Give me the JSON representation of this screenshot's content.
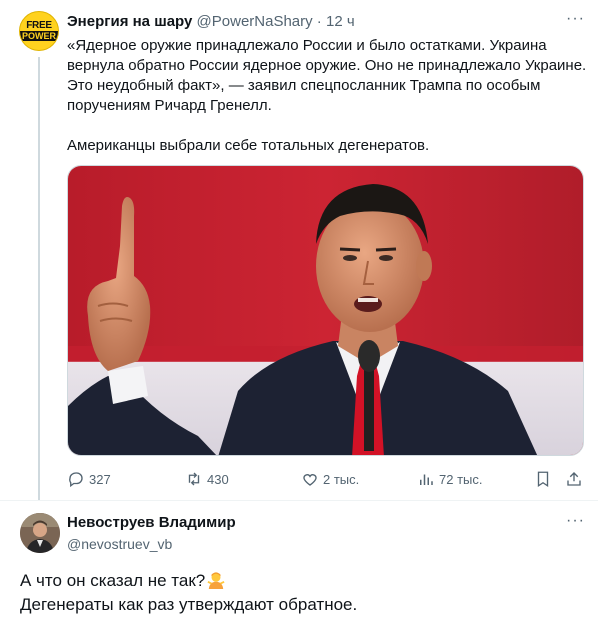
{
  "tweet": {
    "author_name": "Энергия на шару",
    "author_handle": "@PowerNaShary",
    "separator": " · ",
    "time": "12 ч",
    "avatar_text_top": "FREE",
    "avatar_text_bottom": "POWER",
    "paragraph1": "«Ядерное оружие принадлежало России и было остатками. Украина вернула обратно России ядерное оружие. Оно не принадлежало Украине. Это неудобный факт», — заявил спецпосланник Трампа по особым поручениям Ричард Гренелл.",
    "paragraph2": "Американцы выбрали себе тотальных дегенератов.",
    "more": "···",
    "stats": {
      "replies": "327",
      "reposts": "430",
      "likes": "2 тыс.",
      "views": "72 тыс."
    },
    "icons": [
      "reply-icon",
      "repost-icon",
      "like-icon",
      "views-icon",
      "bookmark-icon",
      "share-icon"
    ]
  },
  "reply": {
    "author_name": "Невоструев Владимир",
    "author_handle": "@nevostruev_vb",
    "more": "···",
    "line1": "А что он сказал не так?",
    "line2": "Дегенераты как раз утверждают обратное.",
    "emoji": "person-shrugging-emoji"
  },
  "colors": {
    "text": "#0f1419",
    "muted": "#536471",
    "border": "#cfd9de",
    "avatar_bg": "#ffd21f"
  }
}
